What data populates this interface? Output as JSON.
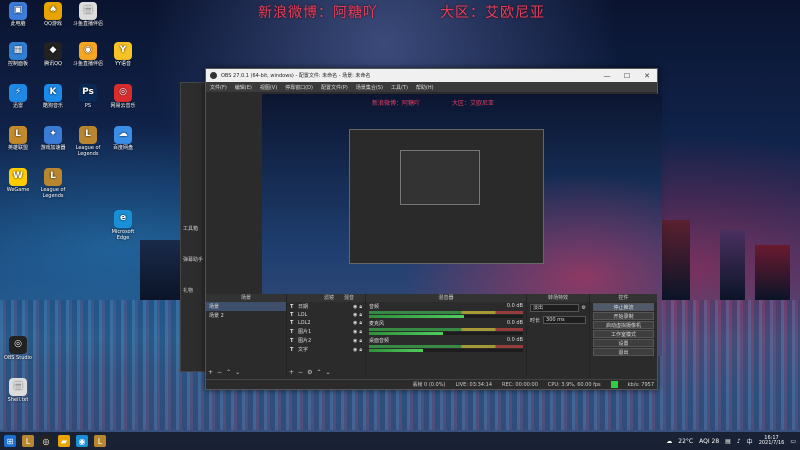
{
  "banner": {
    "left": "新浪微博：阿糖吖",
    "right": "大区：艾欧尼亚"
  },
  "desktop_icons": [
    {
      "label": "此电脑",
      "icon": "computer-icon",
      "color": "#3b7dd8"
    },
    {
      "label": "QQ游戏",
      "icon": "qq-game-icon",
      "color": "#e8a400"
    },
    {
      "label": "斗鱼直播伴侣",
      "icon": "document-icon",
      "color": "#dddddd"
    },
    {
      "label": "控制面板",
      "icon": "control-panel-icon",
      "color": "#2e7fd2"
    },
    {
      "label": "腾讯QQ",
      "icon": "qq-penguin-icon",
      "color": "#222222"
    },
    {
      "label": "斗鱼直播伴侣",
      "icon": "live-icon",
      "color": "#f5a623"
    },
    {
      "label": "YY语音",
      "icon": "yy-icon",
      "color": "#f7c325"
    },
    {
      "label": "迅雷",
      "icon": "thunder-icon",
      "color": "#1e88e5"
    },
    {
      "label": "酷狗音乐",
      "icon": "kugou-icon",
      "color": "#1c8ae8"
    },
    {
      "label": "PS",
      "icon": "photoshop-icon",
      "color": "#0a2a55"
    },
    {
      "label": "网易云音乐",
      "icon": "netease-music-icon",
      "color": "#d92d2d"
    },
    {
      "label": "英雄联盟",
      "icon": "league-icon",
      "color": "#c48a2a"
    },
    {
      "label": "游戏加速器",
      "icon": "booster-icon",
      "color": "#3a7bd5"
    },
    {
      "label": "League of Legends",
      "icon": "lol-icon",
      "color": "#b8862e"
    },
    {
      "label": "百度网盘",
      "icon": "baidu-disk-icon",
      "color": "#3b8ee8"
    },
    {
      "label": "WeGame",
      "icon": "wegame-icon",
      "color": "#ffcc00"
    },
    {
      "label": "League of Legends",
      "icon": "lol-icon",
      "color": "#b8862e"
    },
    {
      "label": "Microsoft Edge",
      "icon": "edge-icon",
      "color": "#1a8fd6"
    },
    {
      "label": "OBS Studio",
      "icon": "obs-icon",
      "color": "#222222"
    },
    {
      "label": "Shell.txt",
      "icon": "text-file-icon",
      "color": "#dddddd"
    }
  ],
  "obs": {
    "window_title": "OBS 27.0.1 (64-bit, windows) - 配置文件: 未命名 - 场景: 未命名",
    "win_minimize": "—",
    "win_maximize": "☐",
    "win_close": "✕",
    "menu": [
      "文件(F)",
      "编辑(E)",
      "视图(V)",
      "停靠窗口(D)",
      "配置文件(P)",
      "场景集合(S)",
      "工具(T)",
      "帮助(H)"
    ],
    "side_items": [
      "工具箱",
      "弹幕助手",
      "礼物"
    ],
    "preview_overlay_left": "新浪微博：阿糖吖",
    "preview_overlay_right": "大区：艾欧尼亚",
    "tabs": [
      "滤镜",
      "混音"
    ],
    "docks": {
      "scenes_title": "场景",
      "sources_title": "来源",
      "mixer_title": "混音器",
      "transitions_title": "转场特效",
      "controls_title": "控件"
    },
    "scenes": [
      "场景",
      "场景 2"
    ],
    "sources": [
      "日期",
      "LOL",
      "LOL2",
      "图片1",
      "图片2",
      "文字"
    ],
    "mixer": [
      {
        "name": "音频",
        "value": "0.0 dB",
        "level": 0.62
      },
      {
        "name": "麦克风",
        "value": "0.0 dB",
        "level": 0.48
      },
      {
        "name": "桌面音频",
        "value": "0.0 dB",
        "level": 0.35
      }
    ],
    "transition": {
      "type": "淡出",
      "duration_label": "时长",
      "duration_value": "300 ms"
    },
    "controls": [
      "停止推流",
      "开始录制",
      "启动虚拟摄像机",
      "工作室模式",
      "设置",
      "退出"
    ],
    "status": {
      "dropped": "丢帧 0 (0.0%)",
      "live": "LIVE: 03:34:14",
      "rec": "REC: 00:00:00",
      "cpu": "CPU: 3.9%, 60.00 fps",
      "bitrate": "kb/s: 7957"
    }
  },
  "taskbar": {
    "start_icon": "windows-icon",
    "apps": [
      "league-icon",
      "obs-icon",
      "folder-icon",
      "browser-icon",
      "league-icon"
    ],
    "weather": "22°C",
    "aqi": "AQI 28",
    "language": "中",
    "time": "16:17",
    "date": "2021/7/16"
  }
}
